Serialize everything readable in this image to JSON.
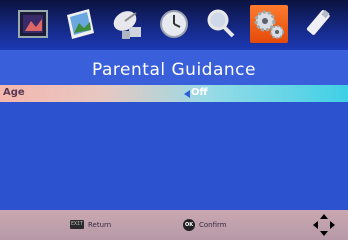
{
  "toolbar": {
    "icons": [
      {
        "name": "picture-icon",
        "active": false
      },
      {
        "name": "photo-icon",
        "active": false
      },
      {
        "name": "channel-icon",
        "active": false
      },
      {
        "name": "clock-icon",
        "active": false
      },
      {
        "name": "search-icon",
        "active": false
      },
      {
        "name": "gear-icon",
        "active": true
      },
      {
        "name": "usb-icon",
        "active": false
      }
    ]
  },
  "page": {
    "title": "Parental Guidance"
  },
  "menu": {
    "items": [
      {
        "label": "Age",
        "value": "Off",
        "selected": true
      }
    ]
  },
  "footer": {
    "exit_key": "EXIT",
    "return_label": "Return",
    "ok_key": "OK",
    "confirm_label": "Confirm"
  },
  "colors": {
    "background": "#2f4fc4",
    "accent": "#e44a0a",
    "selected_row": "#3fd0e6",
    "footer": "#caa8b0"
  }
}
